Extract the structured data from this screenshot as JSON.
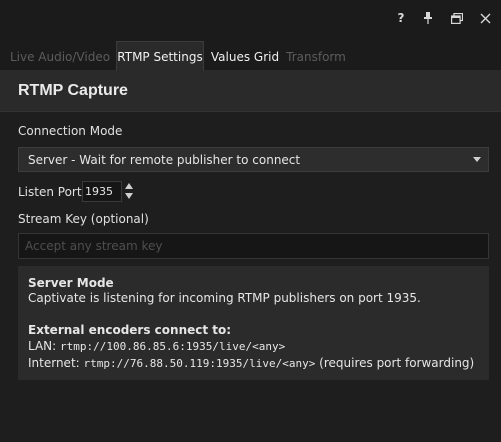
{
  "titlebar": {
    "help_label": "?",
    "icons": [
      "help-icon",
      "pin-icon",
      "restore-window-icon",
      "close-icon"
    ]
  },
  "tabs": [
    {
      "label": "Live Audio/Video",
      "state": "inactive"
    },
    {
      "label": "RTMP Settings",
      "state": "active"
    },
    {
      "label": "Values Grid",
      "state": "normal"
    },
    {
      "label": "Transform",
      "state": "inactive"
    }
  ],
  "section": {
    "title": "RTMP Capture"
  },
  "connection_mode": {
    "label": "Connection Mode",
    "selected": "Server - Wait for remote publisher to connect"
  },
  "listen_port": {
    "label": "Listen Port",
    "value": "1935"
  },
  "stream_key": {
    "label": "Stream Key (optional)",
    "value": "",
    "placeholder": "Accept any stream key"
  },
  "info": {
    "heading": "Server Mode",
    "description": "Captivate is listening for incoming RTMP publishers on port 1935.",
    "encoders_heading": "External encoders connect to:",
    "lan_label": "LAN:",
    "lan_url": "rtmp://100.86.85.6:1935/live/<any>",
    "internet_label": "Internet:",
    "internet_url": "rtmp://76.88.50.119:1935/live/<any>",
    "internet_note": "(requires port forwarding)"
  },
  "colors": {
    "background": "#1b1b1b",
    "panel": "#2a2a2a",
    "text": "#e6e6e6",
    "muted": "#5c5c5c"
  }
}
